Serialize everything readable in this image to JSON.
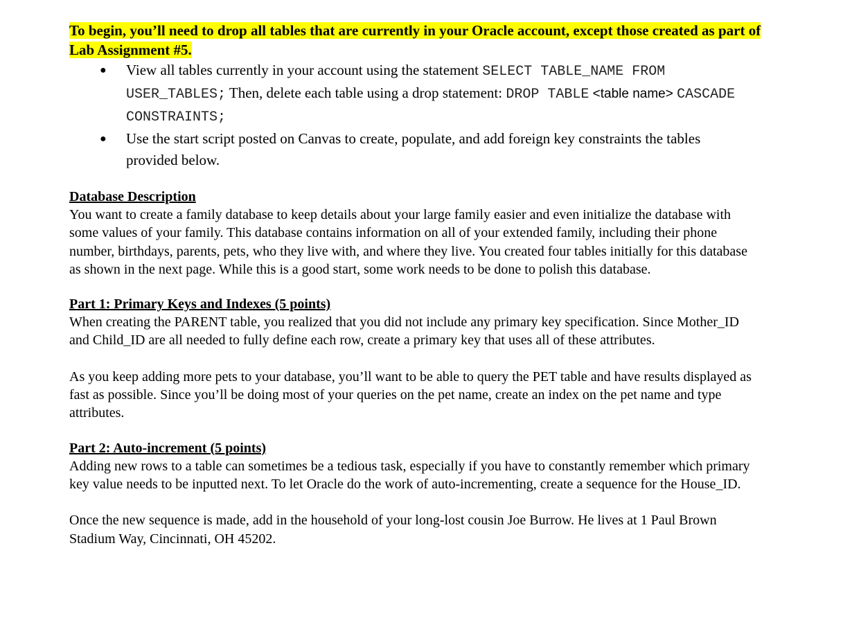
{
  "intro": {
    "text": "To begin, you’ll need to drop all tables that are currently in your Oracle account, except those created as part of Lab Assignment #5.",
    "highlight_color": "#ffff00"
  },
  "bullets": [
    {
      "parts": [
        {
          "type": "text",
          "value": "View all tables currently in your account using the statement "
        },
        {
          "type": "code",
          "value": "SELECT TABLE_NAME FROM USER_TABLES;"
        },
        {
          "type": "text",
          "value": " Then, delete each table using a drop statement: "
        },
        {
          "type": "code",
          "value": "DROP TABLE"
        },
        {
          "type": "text",
          "value": " "
        },
        {
          "type": "placeholder",
          "value": "<table name>"
        },
        {
          "type": "text",
          "value": " "
        },
        {
          "type": "code",
          "value": "CASCADE CONSTRAINTS;"
        }
      ]
    },
    {
      "parts": [
        {
          "type": "text",
          "value": "Use the start script posted on Canvas to create, populate, and add foreign key constraints the tables provided below."
        }
      ]
    }
  ],
  "sections": [
    {
      "heading": "Database Description",
      "paragraphs": [
        "You want to create a family database to keep details about your large family easier and even initialize the database with some values of your family. This database contains information on all of your extended family, including their phone number, birthdays, parents, pets, who they live with, and where they live. You created four tables initially for this database as shown in the next page. While this is a good start, some work needs to be done to polish this database."
      ]
    },
    {
      "heading": "Part 1: Primary Keys and Indexes (5 points)",
      "paragraphs": [
        "When creating the PARENT table, you realized that you did not include any primary key specification. Since Mother_ID and Child_ID are all needed to fully define each row, create a primary key that uses all of these attributes.",
        "As you keep adding more pets to your database, you’ll want to be able to query the PET table and have results displayed as fast as possible. Since you’ll be doing most of your queries on the pet name, create an index on the pet name and type attributes."
      ]
    },
    {
      "heading": "Part 2: Auto-increment (5 points)",
      "paragraphs": [
        "Adding new rows to a table can sometimes be a tedious task, especially if you have to constantly remember which primary key value needs to be inputted next. To let Oracle do the work of auto-incrementing, create a sequence for the House_ID.",
        "Once the new sequence is made, add in the household of your long-lost cousin Joe Burrow. He lives at 1 Paul Brown Stadium Way, Cincinnati, OH 45202."
      ]
    }
  ]
}
